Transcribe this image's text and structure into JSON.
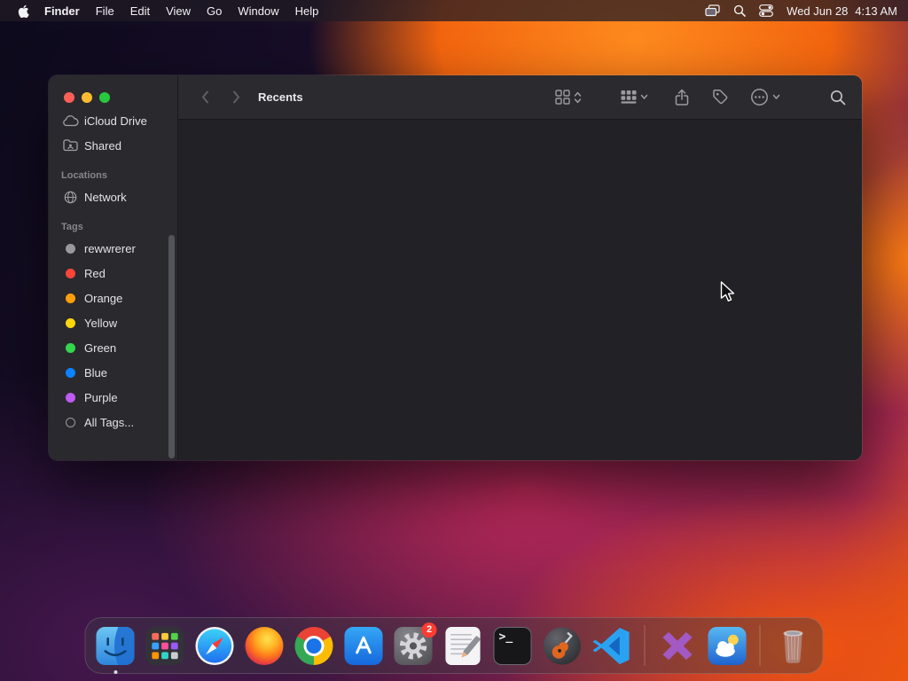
{
  "menu_bar": {
    "app_name": "Finder",
    "menus": [
      "File",
      "Edit",
      "View",
      "Go",
      "Window",
      "Help"
    ],
    "date": "Wed Jun 28",
    "time": "4:13 AM"
  },
  "window": {
    "title": "Recents",
    "traffic_lights": {
      "close": "#ff5f57",
      "minimize": "#febc2e",
      "zoom": "#28c840"
    },
    "sidebar": {
      "favorites": [
        {
          "label": "iCloud Drive",
          "icon": "cloud-icon"
        },
        {
          "label": "Shared",
          "icon": "shared-folder-icon"
        }
      ],
      "locations_header": "Locations",
      "locations": [
        {
          "label": "Network",
          "icon": "globe-icon"
        }
      ],
      "tags_header": "Tags",
      "tags": [
        {
          "label": "rewwrerer",
          "color": "#98989d"
        },
        {
          "label": "Red",
          "color": "#ff453a"
        },
        {
          "label": "Orange",
          "color": "#ff9f0a"
        },
        {
          "label": "Yellow",
          "color": "#ffd60a"
        },
        {
          "label": "Green",
          "color": "#32d74b"
        },
        {
          "label": "Blue",
          "color": "#0a84ff"
        },
        {
          "label": "Purple",
          "color": "#bf5af2"
        }
      ],
      "all_tags": {
        "label": "All Tags..."
      }
    }
  },
  "dock": {
    "items": [
      "Finder",
      "Launchpad",
      "Safari",
      "Firefox",
      "Chrome",
      "App Store",
      "System Settings",
      "TextEdit",
      "Terminal",
      "GarageBand",
      "Visual Studio Code",
      "Visual Studio",
      "Weather",
      "Trash"
    ],
    "settings_badge": "2",
    "terminal_glyph": "&gt;_"
  }
}
